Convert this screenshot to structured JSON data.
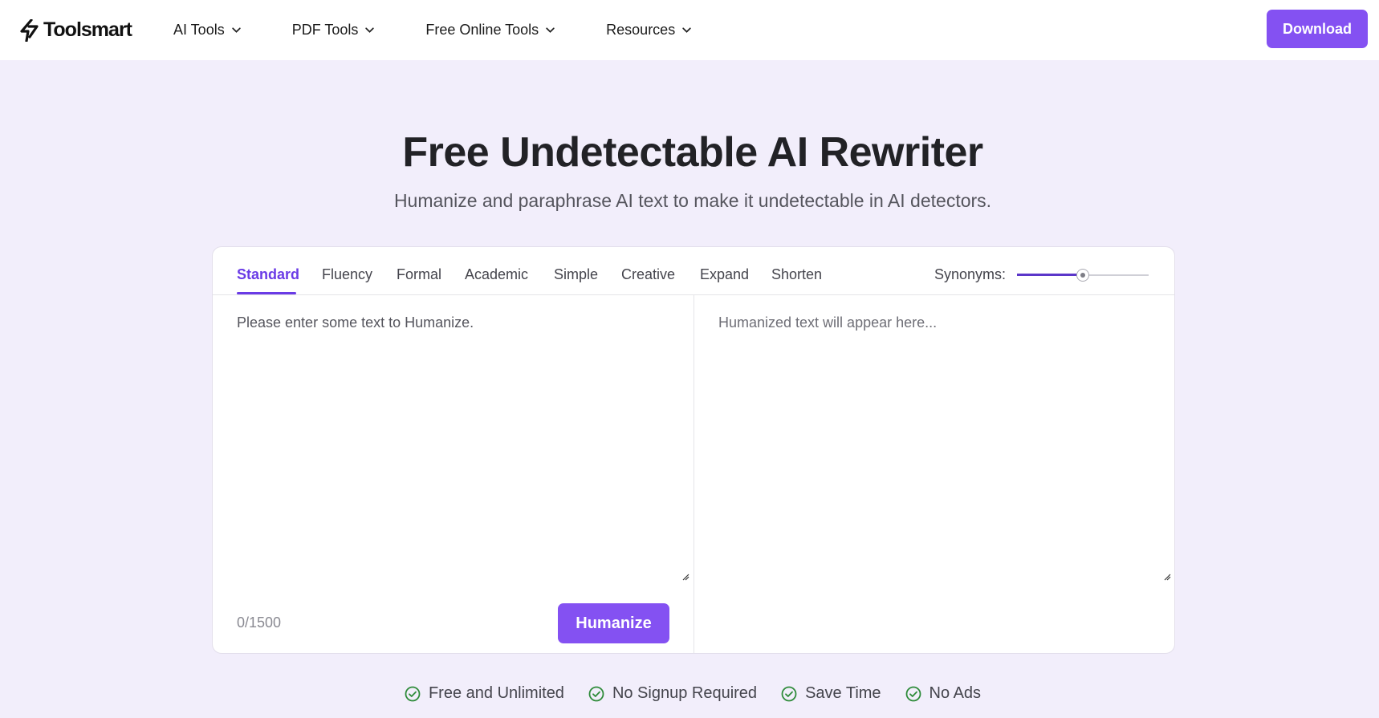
{
  "brand": {
    "name": "Toolsmart",
    "accent": "#8451f2",
    "tab_active_color": "#6a3be6"
  },
  "nav": {
    "items": [
      {
        "label": "AI Tools",
        "icon": "chevron-down-icon"
      },
      {
        "label": "PDF Tools",
        "icon": "chevron-down-icon"
      },
      {
        "label": "Free Online Tools",
        "icon": "chevron-down-icon"
      },
      {
        "label": "Resources",
        "icon": "chevron-down-icon"
      }
    ],
    "download_label": "Download"
  },
  "hero": {
    "title": "Free Undetectable AI Rewriter",
    "subtitle": "Humanize and paraphrase AI text to make it undetectable in AI detectors."
  },
  "tool": {
    "tabs": [
      {
        "label": "Standard",
        "active": true
      },
      {
        "label": "Fluency",
        "active": false
      },
      {
        "label": "Formal",
        "active": false
      },
      {
        "label": "Academic",
        "active": false
      },
      {
        "label": "Simple",
        "active": false
      },
      {
        "label": "Creative",
        "active": false
      },
      {
        "label": "Expand",
        "active": false
      },
      {
        "label": "Shorten",
        "active": false
      }
    ],
    "synonyms_label": "Synonyms:",
    "synonyms_level": 0.5,
    "input_placeholder": "Please enter some text to Humanize.",
    "input_value": "",
    "output_placeholder": "Humanized text will appear here...",
    "char_count": "0/1500",
    "humanize_label": "Humanize"
  },
  "features": [
    {
      "label": "Free and Unlimited",
      "icon": "check-circle-icon"
    },
    {
      "label": "No Signup Required",
      "icon": "check-circle-icon"
    },
    {
      "label": "Save Time",
      "icon": "check-circle-icon"
    },
    {
      "label": "No Ads",
      "icon": "check-circle-icon"
    }
  ]
}
